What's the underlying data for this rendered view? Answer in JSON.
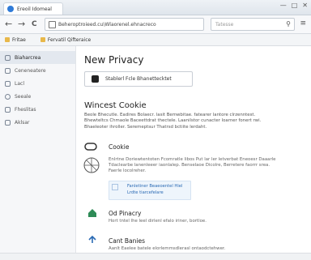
{
  "window": {
    "tab_title": "Ereoil Idomeal",
    "controls": [
      "—",
      "□",
      "✕"
    ]
  },
  "nav": {
    "back": "←",
    "forward": "→",
    "reload": "C",
    "url": "Beheroptroieed.cu\\Wlaorenel.ehnacreco",
    "search_placeholder": "Tatesse",
    "menu": "≡"
  },
  "bookmarks": [
    "Fritae",
    "Fervatil Qifteraice"
  ],
  "sidebar": {
    "items": [
      {
        "label": "Biaharcrea",
        "icon": "shield-icon",
        "active": true
      },
      {
        "label": "Ceneneatere",
        "icon": "users-icon",
        "active": false
      },
      {
        "label": "Lacl",
        "icon": "lock-icon",
        "active": false
      },
      {
        "label": "Seeale",
        "icon": "search-icon",
        "active": false
      },
      {
        "label": "Fheslitas",
        "icon": "history-icon",
        "active": false
      },
      {
        "label": "Aklsar",
        "icon": "bell-icon",
        "active": false
      }
    ]
  },
  "main": {
    "title": "New Privacy",
    "setting_button": "Stablerl Fcle Bhanettecktet",
    "section_title": "Wincest Cookie",
    "section_text": "Beole Bhecutle. Eadires Bolaecr. lasit Bemwbitae. fatearer lantore clrzenntest. Bhewteltcs Chmaole Baceettdrat thectele. Laanilstor cunacter loarner fonert rwi. Bhaeleoter ihroller. Seremeptsur Thatrsd bctiite lerdaht.",
    "cookie": {
      "title": "Cookie",
      "desc": "Enlrtne Doriewtentoten Fcomratle libos Put lar ler letverbat Eneoesr Daaarle Tdaclearbe lanenleeer iaonlalep. Benselaoe Dicolre, Berretere faorrr srea. Faerle locolreher.",
      "link_line1": "Fanletiner Beaeoentel Hiel",
      "link_line2": "Lrdte tiarcefelare"
    },
    "privacy": {
      "title": "Od Pinacry",
      "desc": "Hort tntel lhe leel dirlenl efalo iriner, bortloe."
    },
    "cant": {
      "title": "Cant Banies",
      "desc": "Aanlt Eaelee batele elorlemmsdlerasl ontaodctehwer."
    }
  }
}
